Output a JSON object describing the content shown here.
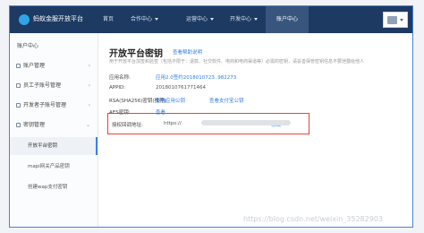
{
  "app": {
    "brand": "蚂蚁金服开放平台",
    "nav": [
      {
        "label": "首页",
        "dropdown": false,
        "active": false
      },
      {
        "label": "合作中心",
        "dropdown": true,
        "active": false
      },
      {
        "label": "运营中心",
        "dropdown": true,
        "active": false
      },
      {
        "label": "开发中心",
        "dropdown": true,
        "active": false
      },
      {
        "label": "账户中心",
        "dropdown": false,
        "active": true
      }
    ]
  },
  "sidebar": {
    "items": [
      {
        "label": "账户中心"
      },
      {
        "label": "账户管理"
      },
      {
        "label": "员工子账号管理"
      },
      {
        "label": "开发者子账号管理"
      },
      {
        "label": "密钥管理"
      }
    ],
    "subitems": [
      {
        "label": "开放平台密钥",
        "active": true
      },
      {
        "label": "mapi网关产品密钥",
        "active": false
      },
      {
        "label": "创建wap支付密钥",
        "active": false
      }
    ]
  },
  "main": {
    "title": "开放平台密钥",
    "title_link": "查看帮助说明",
    "description": "用于开放平台加签和验签（包括不限于：退款、社交软件、电商和电商渠道等）必需的密钥，请妥善保管密钥信息不要泄露给他人",
    "rows": [
      {
        "label": "应用名称:",
        "value": "应用2.0签约2018010723..982273",
        "link": ""
      },
      {
        "label": "APPID:",
        "value": "2018010761771464",
        "link": ""
      },
      {
        "label": "RSA(SHA256)密钥(推荐):",
        "value": "查看应用公钥",
        "link": "查看支付宝公钥"
      },
      {
        "label": "AES密钥:",
        "value": "查看",
        "link": ""
      }
    ],
    "auth_callback": {
      "label": "授权回调地址:",
      "value": "https://",
      "action": "修改"
    }
  },
  "watermark": "https://blog.csdn.net/weixin_35282903",
  "colors": {
    "topbar": "#1d3a63",
    "accent": "#2f7ee6",
    "highlight": "#e2453c"
  }
}
